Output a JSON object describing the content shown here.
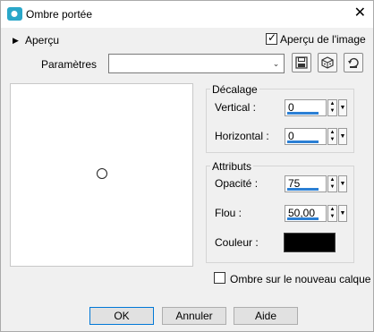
{
  "window": {
    "title": "Ombre portée",
    "close_glyph": "✕"
  },
  "preview_section": {
    "label": "Aperçu",
    "arrow_glyph": "▶",
    "apercu_image_label": "Aperçu de l'image",
    "apercu_image_checked": true,
    "check_glyph": "✓"
  },
  "parametres": {
    "label": "Paramètres",
    "value": "",
    "dropdown_glyph": "⌄",
    "toolbar_icons": [
      "save-preset-icon",
      "randomize-dice-icon",
      "reset-icon"
    ]
  },
  "decalage": {
    "title": "Décalage",
    "vertical": {
      "label": "Vertical :",
      "value": "0"
    },
    "horizontal": {
      "label": "Horizontal :",
      "value": "0"
    }
  },
  "attributs": {
    "title": "Attributs",
    "opacite": {
      "label": "Opacité :",
      "value": "75"
    },
    "flou": {
      "label": "Flou :",
      "value": "50,00"
    },
    "couleur": {
      "label": "Couleur :",
      "color": "#000000"
    }
  },
  "ombre_calque": {
    "label": "Ombre sur le nouveau calque",
    "checked": false
  },
  "spinner": {
    "up": "▲",
    "down": "▼",
    "dropdown": "▼"
  },
  "buttons": {
    "ok": "OK",
    "annuler": "Annuler",
    "aide": "Aide"
  },
  "colors": {
    "accent": "#2b7fd4",
    "window_bg": "#f0f0f0",
    "app_icon": "#2aa7c9"
  }
}
